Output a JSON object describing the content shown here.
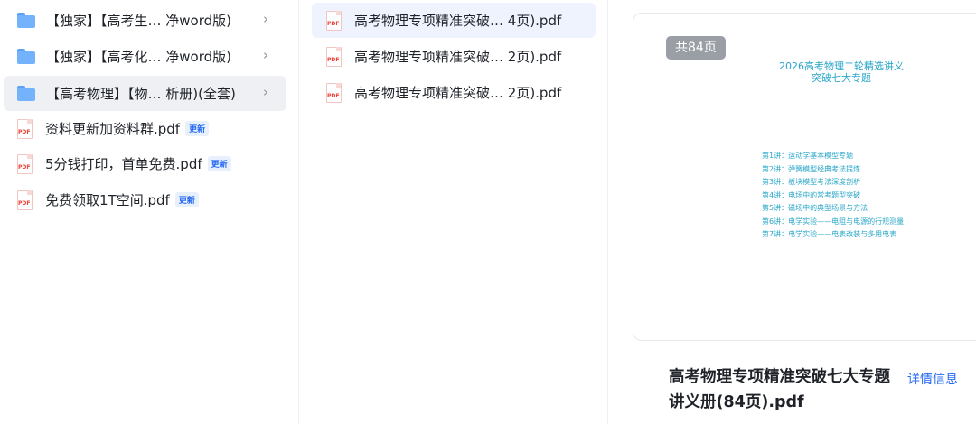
{
  "left_pane": {
    "items": [
      {
        "type": "folder",
        "label": "【独家】【高考生… 净word版)",
        "chevron": "›"
      },
      {
        "type": "folder",
        "label": "【独家】【高考化… 净word版)",
        "chevron": "›"
      },
      {
        "type": "folder",
        "label": "【高考物理】【物… 析册)(全套)",
        "chevron": "›"
      },
      {
        "type": "pdf",
        "label": "资料更新加资料群.pdf",
        "badge": "更新"
      },
      {
        "type": "pdf",
        "label": "5分钱打印，首单免费.pdf",
        "badge": "更新"
      },
      {
        "type": "pdf",
        "label": "免费领取1T空间.pdf",
        "badge": "更新"
      }
    ]
  },
  "middle_pane": {
    "items": [
      {
        "label": "高考物理专项精准突破…  4页).pdf"
      },
      {
        "label": "高考物理专项精准突破…  2页).pdf"
      },
      {
        "label": "高考物理专项精准突破…  2页).pdf"
      }
    ]
  },
  "icons": {
    "pdf_text": "PDF"
  },
  "preview": {
    "page_count": "共84页",
    "doc_title_line1": "2026高考物理二轮精选讲义",
    "doc_title_line2": "突破七大专题",
    "toc": [
      "第1讲：运动学基本模型专题",
      "第2讲：弹簧模型经典考法提炼",
      "第3讲：板块模型考法深度剖析",
      "第4讲：电场中的常考题型突破",
      "第5讲：磁场中的典型场景与方法",
      "第6讲：电学实验——电阻与电源的行规测量",
      "第7讲：电学实验——电表改装与多用电表"
    ],
    "file_title": "高考物理专项精准突破七大专题 讲义册(84页).pdf",
    "detail_link": "详情信息"
  },
  "colors": {
    "accent": "#2468f2",
    "selected_left": "#eef0f3",
    "selected_middle": "#eef3fd",
    "pdf_red": "#ef4136",
    "toc_cyan": "#2aa7c9"
  }
}
